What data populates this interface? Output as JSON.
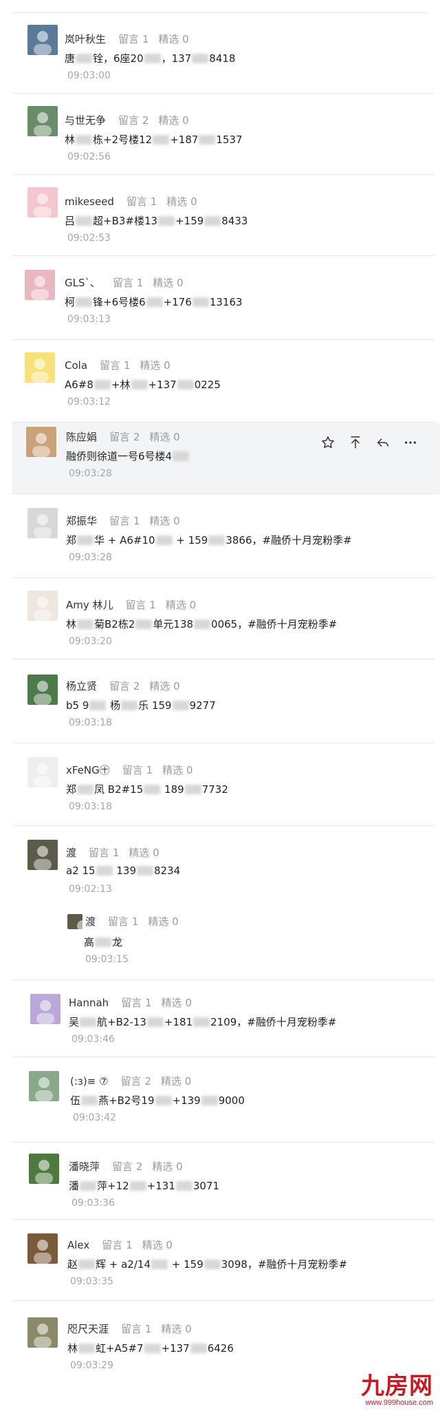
{
  "labels": {
    "reply": "留言",
    "pick": "精选"
  },
  "comments": [
    {
      "nick": "岚叶秋生",
      "reply_count": "1",
      "pick_count": "0",
      "content": [
        "唐",
        "B",
        "铨，6座20",
        "B",
        "，137",
        "B",
        "8418"
      ],
      "time": "09:03:00",
      "avatar_color": "#5a7a9a"
    },
    {
      "nick": "与世无争",
      "reply_count": "2",
      "pick_count": "0",
      "content": [
        "林",
        "B",
        "栋+2号楼12",
        "B",
        "+187",
        "B",
        "1537"
      ],
      "time": "09:02:56",
      "avatar_color": "#6b8c6b"
    },
    {
      "nick": "mikeseed",
      "reply_count": "1",
      "pick_count": "0",
      "content": [
        "吕",
        "B",
        "超+B3#楼13",
        "B",
        "+159",
        "B",
        "8433"
      ],
      "time": "09:02:53",
      "avatar_color": "#f3c6d0"
    },
    {
      "nick": "GLS`、",
      "reply_count": "1",
      "pick_count": "0",
      "content": [
        "柯",
        "B",
        "锋+6号楼6",
        "B",
        "+176",
        "B",
        "13163"
      ],
      "time": "09:03:13",
      "avatar_color": "#e8b7c0"
    },
    {
      "nick": "Cola",
      "reply_count": "1",
      "pick_count": "0",
      "content": [
        "A6#8",
        "B",
        "+林",
        "B",
        "+137",
        "B",
        "0225"
      ],
      "time": "09:03:12",
      "avatar_color": "#f7e27a"
    },
    {
      "nick": "陈应娟",
      "reply_count": "2",
      "pick_count": "0",
      "content": [
        "融侨则徐道一号6号楼4",
        "B"
      ],
      "time": "09:03:28",
      "avatar_color": "#c9a27a"
    },
    {
      "nick": "郑振华",
      "reply_count": "1",
      "pick_count": "0",
      "content": [
        "郑",
        "B",
        "华 + A6#10",
        "B",
        " + 159",
        "B",
        "3866，#融侨十月宠粉季#"
      ],
      "time": "09:03:28",
      "avatar_color": "#d8d8d8"
    },
    {
      "nick": "Amy 林儿",
      "reply_count": "1",
      "pick_count": "0",
      "content": [
        "林",
        "B",
        "菊B2栋2",
        "B",
        "单元138",
        "B",
        "0065，#融侨十月宠粉季#"
      ],
      "time": "09:03:20",
      "avatar_color": "#f0e6e0"
    },
    {
      "nick": "杨立贤",
      "reply_count": "2",
      "pick_count": "0",
      "content": [
        "b5 9",
        "B",
        " 杨",
        "B",
        "乐 159",
        "B",
        "9277"
      ],
      "time": "09:03:18",
      "avatar_color": "#4c7a4a"
    },
    {
      "nick": "xFeNG㊉",
      "reply_count": "1",
      "pick_count": "0",
      "content": [
        "郑",
        "B",
        "凤 B2#15",
        "B",
        " 189",
        "B",
        "7732"
      ],
      "time": "09:03:18",
      "avatar_color": "#eeeeee"
    },
    {
      "nick": "渡",
      "reply_count": "1",
      "pick_count": "0",
      "content": [
        "a2 15",
        "B",
        "  139",
        "B",
        "8234"
      ],
      "time": "09:02:13",
      "avatar_color": "#5c5a4a",
      "reply": {
        "nick": "渡",
        "reply_count": "1",
        "pick_count": "0",
        "content": [
          "高",
          "B",
          "龙"
        ],
        "time": "09:03:15"
      }
    },
    {
      "nick": "Hannah",
      "reply_count": "1",
      "pick_count": "0",
      "content": [
        "吴",
        "B",
        "航+B2-13",
        "B",
        "+181",
        "B",
        "2109，#融侨十月宠粉季#"
      ],
      "time": "09:03:46",
      "avatar_color": "#b9a8d8"
    },
    {
      "nick": "(:з)≡ ⑦",
      "reply_count": "2",
      "pick_count": "0",
      "content": [
        "伍",
        "B",
        "燕+B2号19",
        "B",
        "+139",
        "B",
        "9000"
      ],
      "time": "09:03:42",
      "avatar_color": "#8aa88a"
    },
    {
      "nick": "潘晓萍",
      "reply_count": "2",
      "pick_count": "0",
      "content": [
        "潘",
        "B",
        "萍+12",
        "B",
        "+131",
        "B",
        "3071"
      ],
      "time": "09:03:36",
      "avatar_color": "#4f7a3f"
    },
    {
      "nick": "Alex",
      "reply_count": "1",
      "pick_count": "0",
      "content": [
        "赵",
        "B",
        "辉 + a2/14",
        "B",
        " + 159",
        "B",
        "3098，#融侨十月宠粉季#"
      ],
      "time": "09:03:35",
      "avatar_color": "#7a5a3a"
    },
    {
      "nick": "咫尺天涯",
      "reply_count": "1",
      "pick_count": "0",
      "content": [
        "林",
        "B",
        "虹+A5#7",
        "B",
        "+137",
        "B",
        "6426"
      ],
      "time": "09:03:29",
      "avatar_color": "#8a8a6a"
    }
  ],
  "watermark": {
    "main": "九房网",
    "sub": "www.999house.com"
  }
}
